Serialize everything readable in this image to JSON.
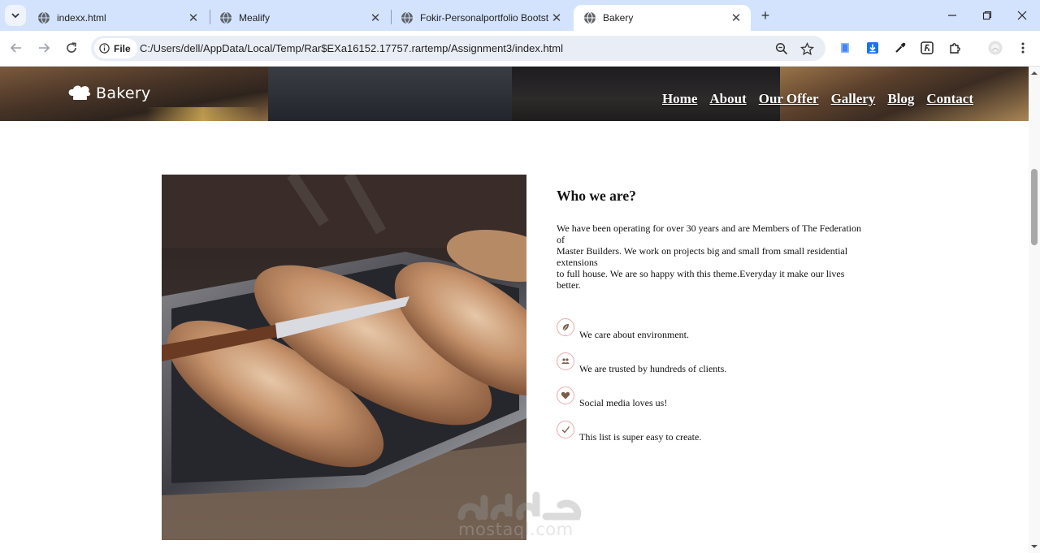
{
  "browser": {
    "tabs": [
      {
        "title": "indexx.html",
        "active": false
      },
      {
        "title": "Mealify",
        "active": false
      },
      {
        "title": "Fokir-Personalportfolio Bootst",
        "active": false
      },
      {
        "title": "Bakery",
        "active": true
      }
    ],
    "address": {
      "chip_label": "File",
      "url": "C:/Users/dell/AppData/Local/Temp/Rar$EXa16152.17757.rartemp/Assignment3/index.html"
    }
  },
  "site": {
    "logo_text": "Bakery",
    "nav": [
      "Home",
      "About",
      "Our Offer",
      "Gallery",
      "Blog",
      "Contact"
    ]
  },
  "about": {
    "heading": "Who we are?",
    "paragraph": "We have been operating for over 30 years and are Members of The Federation\nof\nMaster Builders. We work on projects big and small from small residential\nextensions\nto full house. We are so happy with this theme.Everyday it make our lives\nbetter.",
    "features": [
      {
        "icon": "leaf-icon",
        "text": "We care about environment."
      },
      {
        "icon": "people-icon",
        "text": "We are trusted by hundreds of clients."
      },
      {
        "icon": "heart-icon",
        "text": "Social media loves us!"
      },
      {
        "icon": "check-icon",
        "text": "This list is super easy to create."
      }
    ]
  },
  "watermark": {
    "text": "mostaql.com"
  },
  "colors": {
    "tabstrip": "#d3e3fd",
    "badge_border": "#e8a9ad",
    "badge_icon": "#7a5c4a"
  }
}
